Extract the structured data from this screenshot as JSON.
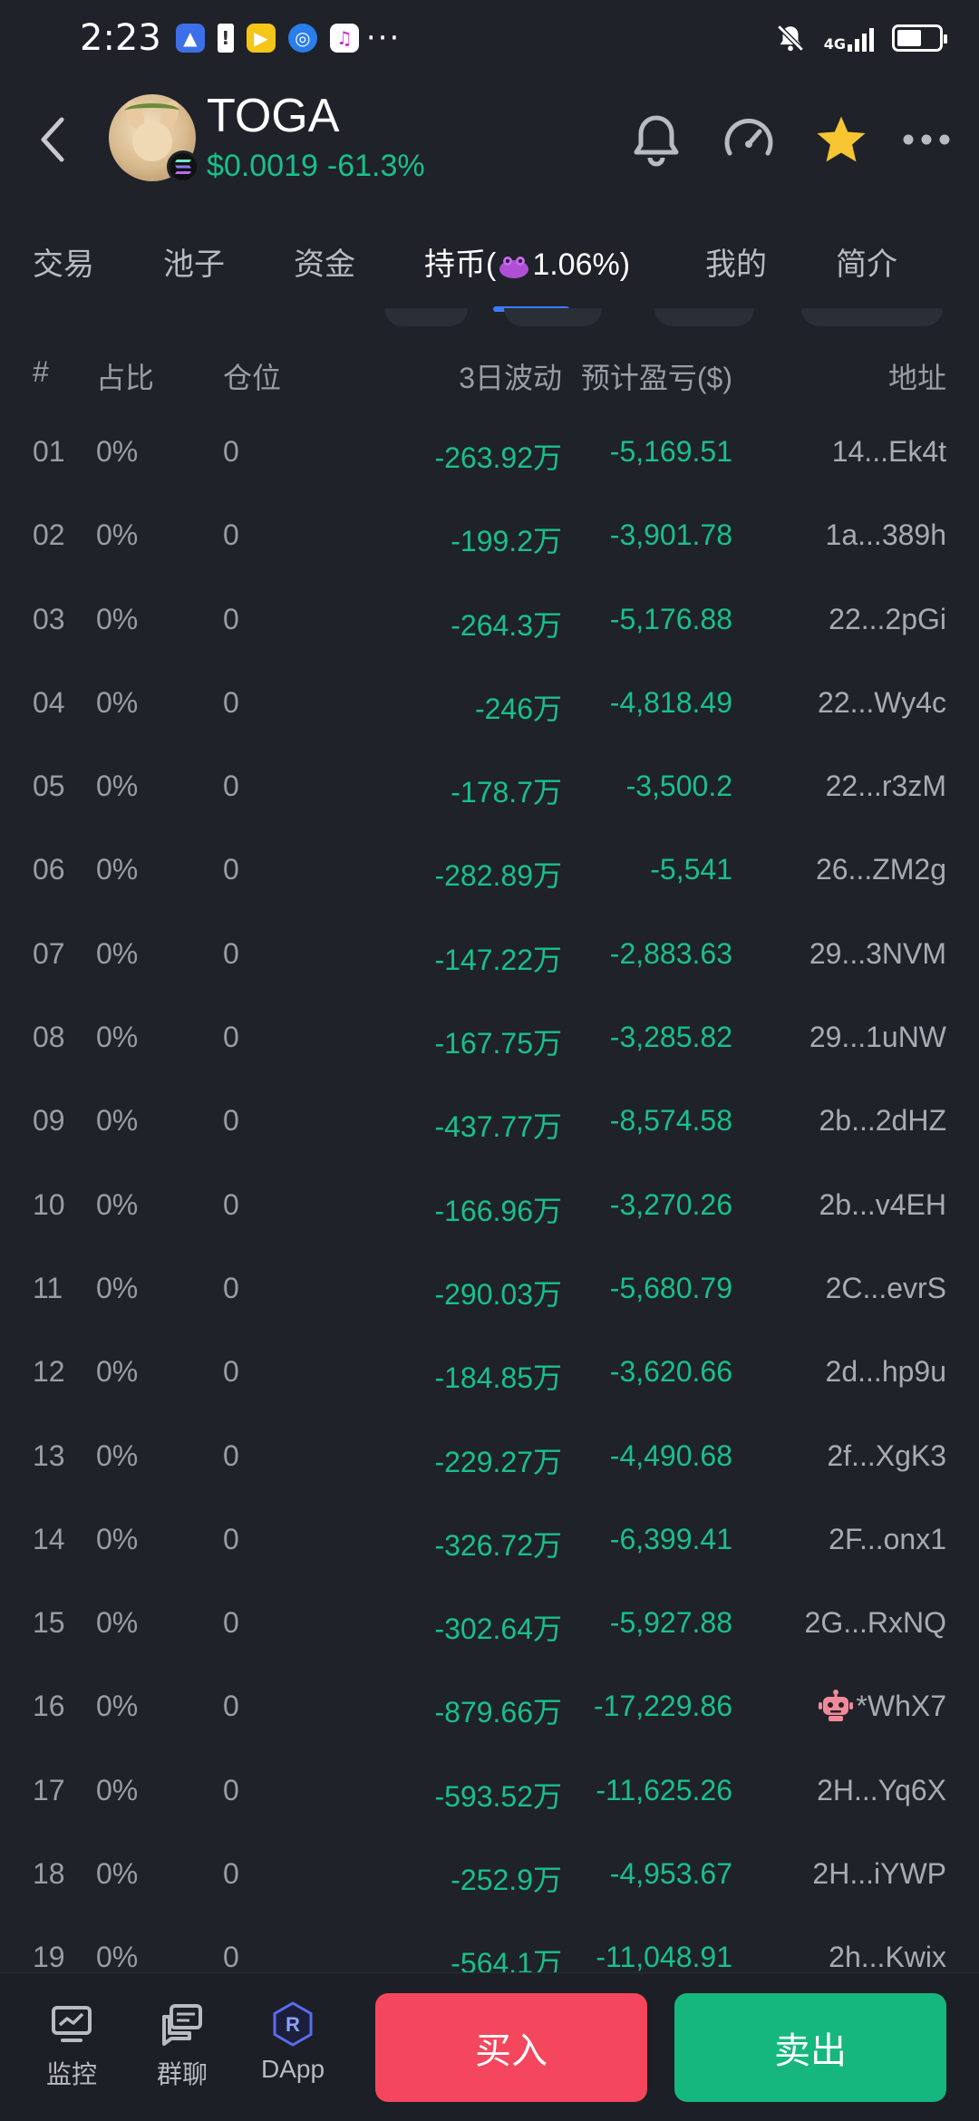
{
  "status_bar": {
    "time": "2:23",
    "more_indicator": "···",
    "network": "4G"
  },
  "header": {
    "token_symbol": "TOGA",
    "price": "$0.0019",
    "change": "-61.3%",
    "favorited": true,
    "colors": {
      "positive": "#19c08a",
      "star": "#f7c531"
    }
  },
  "tabs": [
    {
      "label": "交易",
      "active": false
    },
    {
      "label": "池子",
      "active": false
    },
    {
      "label": "资金",
      "active": false
    },
    {
      "label_prefix": "持币(",
      "label_value": "1.06%)",
      "active": true
    },
    {
      "label": "我的",
      "active": false
    },
    {
      "label": "简介",
      "active": false
    }
  ],
  "table": {
    "headers": {
      "index": "#",
      "share": "占比",
      "position": "仓位",
      "volatility": "3日波动",
      "pnl": "预计盈亏($)",
      "address": "地址"
    },
    "rows": [
      {
        "index": "01",
        "share": "0%",
        "position": "0",
        "volatility": "-263.92万",
        "pnl": "-5,169.51",
        "address": "14...Ek4t"
      },
      {
        "index": "02",
        "share": "0%",
        "position": "0",
        "volatility": "-199.2万",
        "pnl": "-3,901.78",
        "address": "1a...389h"
      },
      {
        "index": "03",
        "share": "0%",
        "position": "0",
        "volatility": "-264.3万",
        "pnl": "-5,176.88",
        "address": "22...2pGi"
      },
      {
        "index": "04",
        "share": "0%",
        "position": "0",
        "volatility": "-246万",
        "pnl": "-4,818.49",
        "address": "22...Wy4c"
      },
      {
        "index": "05",
        "share": "0%",
        "position": "0",
        "volatility": "-178.7万",
        "pnl": "-3,500.2",
        "address": "22...r3zM"
      },
      {
        "index": "06",
        "share": "0%",
        "position": "0",
        "volatility": "-282.89万",
        "pnl": "-5,541",
        "address": "26...ZM2g"
      },
      {
        "index": "07",
        "share": "0%",
        "position": "0",
        "volatility": "-147.22万",
        "pnl": "-2,883.63",
        "address": "29...3NVM"
      },
      {
        "index": "08",
        "share": "0%",
        "position": "0",
        "volatility": "-167.75万",
        "pnl": "-3,285.82",
        "address": "29...1uNW"
      },
      {
        "index": "09",
        "share": "0%",
        "position": "0",
        "volatility": "-437.77万",
        "pnl": "-8,574.58",
        "address": "2b...2dHZ"
      },
      {
        "index": "10",
        "share": "0%",
        "position": "0",
        "volatility": "-166.96万",
        "pnl": "-3,270.26",
        "address": "2b...v4EH"
      },
      {
        "index": "11",
        "share": "0%",
        "position": "0",
        "volatility": "-290.03万",
        "pnl": "-5,680.79",
        "address": "2C...evrS"
      },
      {
        "index": "12",
        "share": "0%",
        "position": "0",
        "volatility": "-184.85万",
        "pnl": "-3,620.66",
        "address": "2d...hp9u"
      },
      {
        "index": "13",
        "share": "0%",
        "position": "0",
        "volatility": "-229.27万",
        "pnl": "-4,490.68",
        "address": "2f...XgK3"
      },
      {
        "index": "14",
        "share": "0%",
        "position": "0",
        "volatility": "-326.72万",
        "pnl": "-6,399.41",
        "address": "2F...onx1"
      },
      {
        "index": "15",
        "share": "0%",
        "position": "0",
        "volatility": "-302.64万",
        "pnl": "-5,927.88",
        "address": "2G...RxNQ"
      },
      {
        "index": "16",
        "share": "0%",
        "position": "0",
        "volatility": "-879.66万",
        "pnl": "-17,229.86",
        "address": "*WhX7",
        "bot": true
      },
      {
        "index": "17",
        "share": "0%",
        "position": "0",
        "volatility": "-593.52万",
        "pnl": "-11,625.26",
        "address": "2H...Yq6X"
      },
      {
        "index": "18",
        "share": "0%",
        "position": "0",
        "volatility": "-252.9万",
        "pnl": "-4,953.67",
        "address": "2H...iYWP"
      },
      {
        "index": "19",
        "share": "0%",
        "position": "0",
        "volatility": "-564.1万",
        "pnl": "-11,048.91",
        "address": "2h...Kwix"
      }
    ]
  },
  "bottom_bar": {
    "monitor_label": "监控",
    "chat_label": "群聊",
    "dapp_label": "DApp",
    "buy_label": "买入",
    "sell_label": "卖出",
    "colors": {
      "buy": "#f4465c",
      "sell": "#15b77e"
    }
  }
}
